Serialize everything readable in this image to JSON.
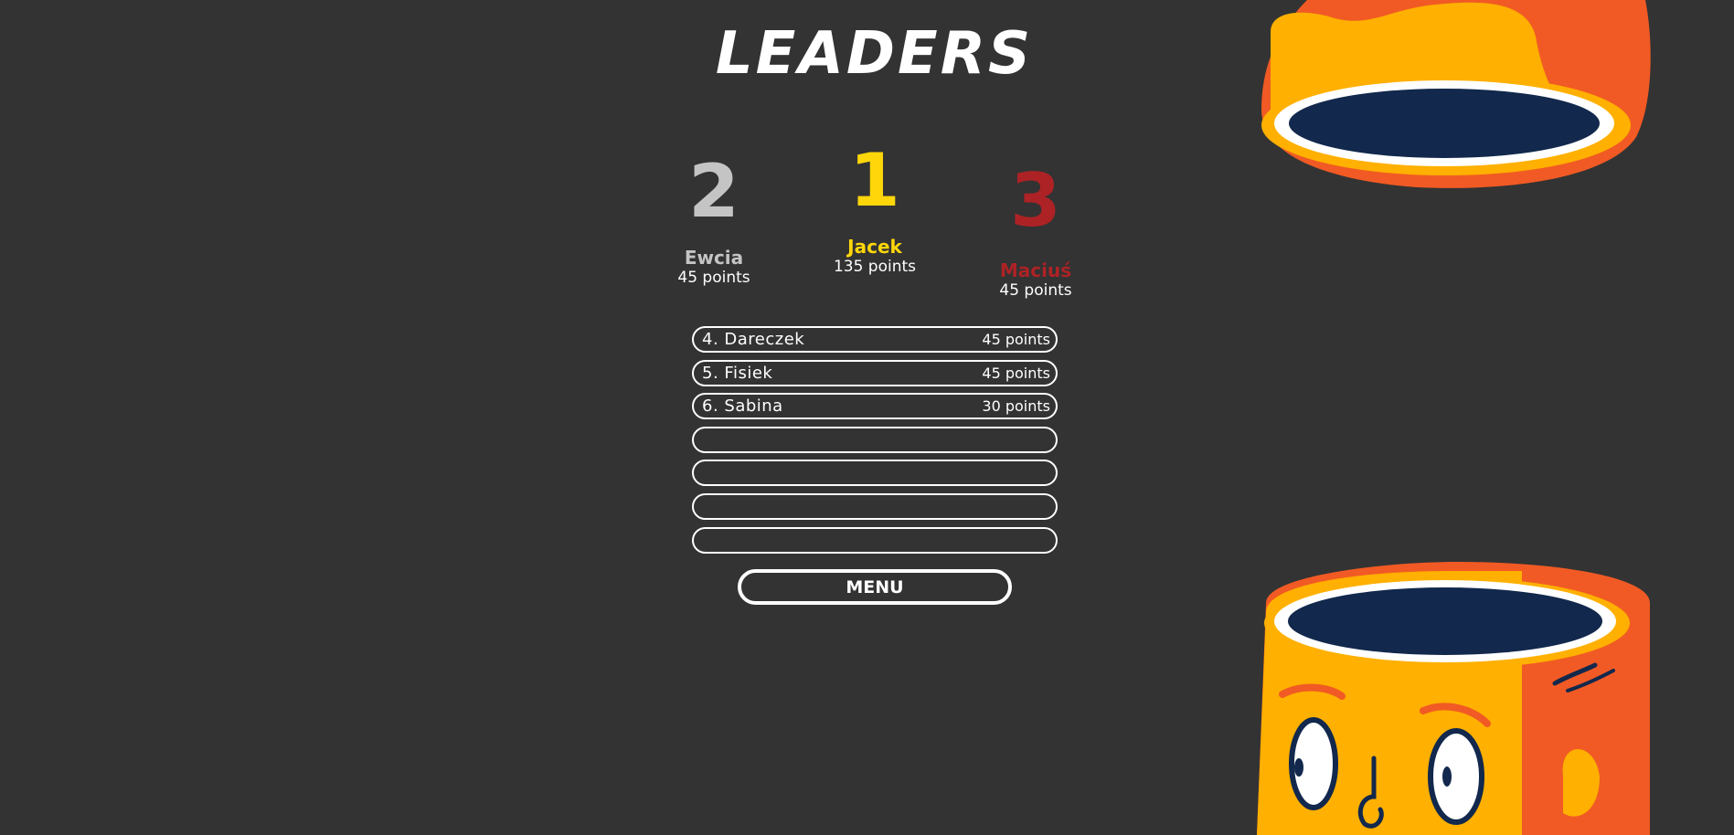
{
  "title": "LEADERS",
  "podium": [
    {
      "rank": "2",
      "name": "Ewcia",
      "points": "45 points",
      "color": "#c4c4c4"
    },
    {
      "rank": "1",
      "name": "Jacek",
      "points": "135 points",
      "color": "#ffd60a"
    },
    {
      "rank": "3",
      "name": "Maciuś",
      "points": "45 points",
      "color": "#ad2225"
    }
  ],
  "leaderboard": [
    {
      "label": "4. Dareczek",
      "points": "45 points"
    },
    {
      "label": "5. Fisiek",
      "points": "45 points"
    },
    {
      "label": "6. Sabina",
      "points": "30 points"
    },
    {
      "label": "",
      "points": ""
    },
    {
      "label": "",
      "points": ""
    },
    {
      "label": "",
      "points": ""
    },
    {
      "label": "",
      "points": ""
    }
  ],
  "menu_button": "MENU",
  "colors": {
    "background": "#333333",
    "first": "#ffd60a",
    "second": "#c4c4c4",
    "third": "#ad2225",
    "mug_orange": "#f15a24",
    "mug_yellow": "#ffb000",
    "mug_navy": "#12284c"
  },
  "icons": [
    "mug-top-illustration",
    "mug-face-illustration"
  ]
}
